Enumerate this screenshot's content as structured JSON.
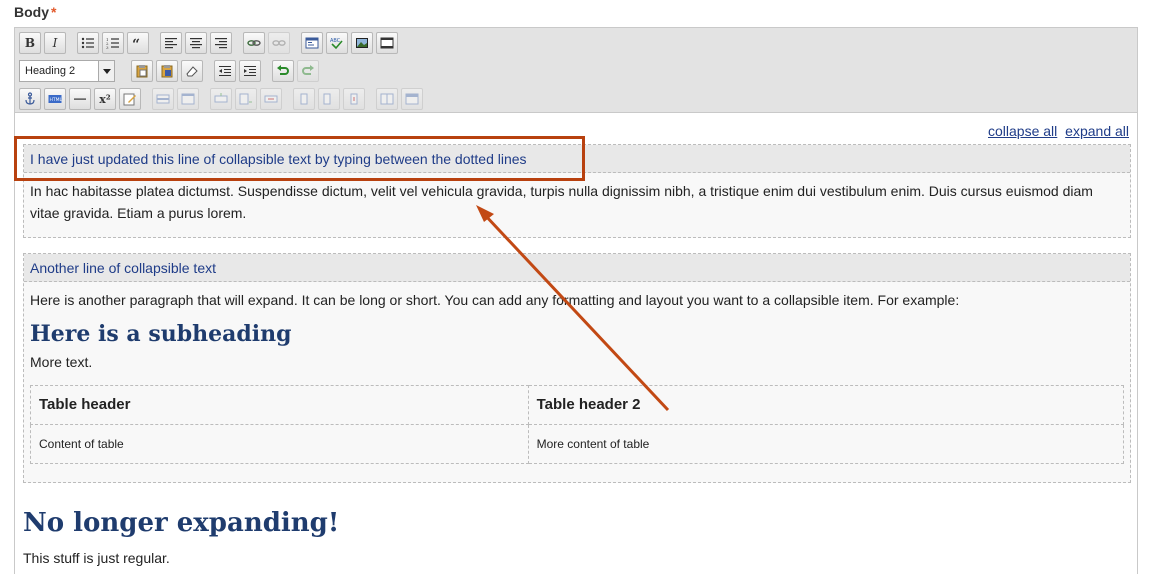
{
  "field": {
    "label": "Body",
    "required_mark": "*"
  },
  "toolbar": {
    "format_select": "Heading 2",
    "bold": "B",
    "italic": "I",
    "superscript": "x²"
  },
  "toggles": {
    "collapse_all": "collapse all",
    "expand_all": "expand all"
  },
  "collapsibles": [
    {
      "title": "I have just updated this line of collapsible text by typing between the dotted lines",
      "body": "In hac habitasse platea dictumst. Suspendisse dictum, velit vel vehicula gravida, turpis nulla dignissim nibh, a tristique enim dui vestibulum enim. Duis cursus euismod diam vitae gravida. Etiam a purus lorem."
    },
    {
      "title": "Another line of collapsible text",
      "body": "Here is another paragraph that will expand. It can be long or short. You can add any formatting and layout you want to a collapsible item. For example:",
      "subheading": "Here is a subheading",
      "more_text": "More text.",
      "table": {
        "headers": [
          "Table header",
          "Table header 2"
        ],
        "rows": [
          [
            "Content of table",
            "More content of table"
          ]
        ]
      }
    }
  ],
  "after": {
    "heading": "No longer expanding!",
    "paragraph": "This stuff is just regular."
  },
  "colors": {
    "annotation": "#b8410f",
    "link": "#1f3c88",
    "heading": "#1f3c6e"
  }
}
